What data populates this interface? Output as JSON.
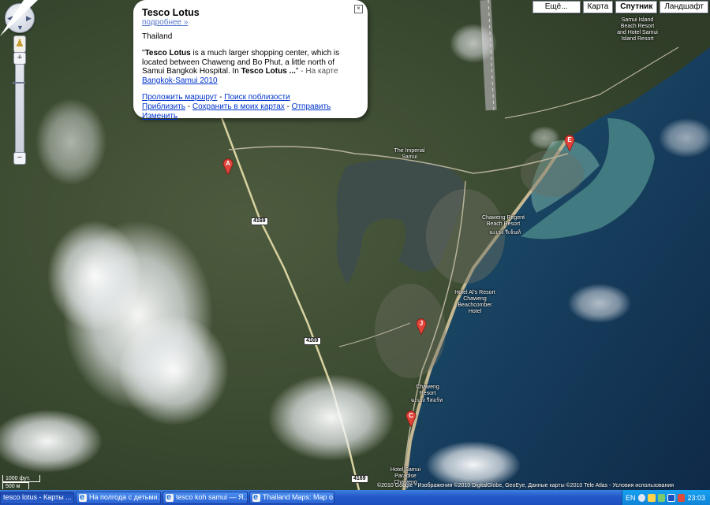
{
  "map_controls": {
    "pan_arrows": [
      "▲",
      "◀",
      "▶",
      "▼"
    ],
    "zoom_in": "+",
    "zoom_out": "−",
    "pegman_icon": "pegman-icon"
  },
  "map_types": {
    "more": "Ещё...",
    "map": "Карта",
    "satellite": "Спутник",
    "terrain": "Ландшафт",
    "active": "satellite"
  },
  "info_window": {
    "title": "Tesco Lotus",
    "more_link": "подробнее »",
    "country": "Thailand",
    "desc_quote_open": "\"",
    "desc_bold1": "Tesco Lotus",
    "desc_text1": " is a much larger shopping center, which is located between Chaweng and Bo Phut, a little north of Samui Bangkok Hospital. In ",
    "desc_bold2": "Tesco Lotus ...",
    "desc_quote_close": "\"",
    "desc_source_prefix": " - На карте ",
    "desc_source_link": "Bangkok-Samui 2010",
    "links": {
      "route": "Проложить маршрут",
      "sep1": " - ",
      "nearby": "Поиск поблизости",
      "zoom": "Приблизить",
      "sep2": " - ",
      "save": "Сохранить в моих картах",
      "sep3": " - ",
      "send": "Отправить",
      "edit": "Изменить"
    },
    "close_label": "×"
  },
  "markers": [
    {
      "letter": "A"
    },
    {
      "letter": "E"
    },
    {
      "letter": "J"
    },
    {
      "letter": "C"
    }
  ],
  "place_labels": {
    "imperial": "The Imperial Samui",
    "samui_island": "Samui Island Beach Resort and Hotel Samui Island Resort",
    "chaweng_regent": "Chaweng Regent Beach Resort",
    "chaweng_regent_thai": "ฉะเวง รีเจ้นท์",
    "hotel_als": "Hotel Al's Resort Chaweng Beachcomber Hotel",
    "chaweng_resort": "Chaweng Resort",
    "chaweng_resort_thai": "ฉะเวง รีสอร์ท",
    "hotel_samui": "Hotel Samui Paradise Chaweng"
  },
  "road_shields": [
    "4169",
    "4169",
    "4169"
  ],
  "scale": {
    "imperial": "1000 фут.",
    "metric": "500 м"
  },
  "copyright": "©2010 Google - Изображения ©2010 DigitalGlobe, GeoEye, Данные карты ©2010 Tele Atlas - Условия использования",
  "taskbar": {
    "buttons": [
      {
        "label": "tesco lotus - Карты ...",
        "active": true
      },
      {
        "label": "На полгода с детьми...",
        "active": false
      },
      {
        "label": "tesco koh samui — Я...",
        "active": false
      },
      {
        "label": "Thailand Maps: Map o...",
        "active": false
      }
    ],
    "tray": {
      "lang": "EN",
      "time": "23:03"
    }
  },
  "colors": {
    "link": "#0033cc",
    "marker": "#e0443a",
    "taskbar": "#2458c8",
    "tray": "#0f83d8"
  }
}
